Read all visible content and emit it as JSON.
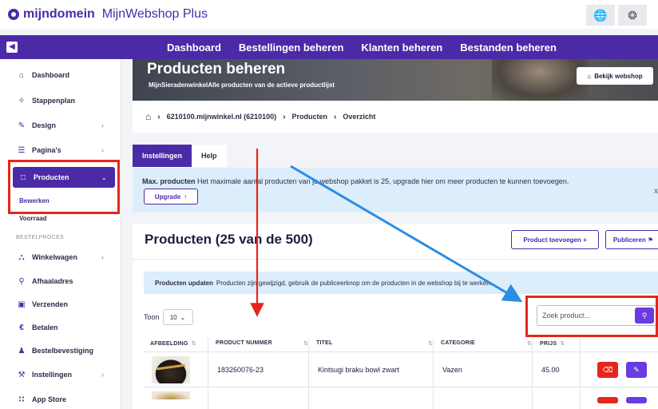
{
  "header": {
    "logo_text": "mijndomein",
    "app_name": "MijnWebshop Plus",
    "globe_icon": "globe-icon",
    "support_icon": "lifebuoy-icon"
  },
  "nav": {
    "links": [
      "Dashboard",
      "Bestellingen beheren",
      "Klanten beheren",
      "Bestanden beheren"
    ]
  },
  "sidebar": {
    "items": [
      {
        "label": "Dashboard",
        "icon": "home-icon"
      },
      {
        "label": "Stappenplan",
        "icon": "wand-icon"
      },
      {
        "label": "Design",
        "icon": "design-icon"
      },
      {
        "label": "Pagina's",
        "icon": "layers-icon"
      },
      {
        "label": "Producten",
        "icon": "box-icon"
      }
    ],
    "sub_items": [
      "Bewerken",
      "Voorraad"
    ],
    "section_label": "BESTELPROCES",
    "section_items": [
      {
        "label": "Winkelwagen",
        "icon": "cart-icon"
      },
      {
        "label": "Afhaaladres",
        "icon": "pin-icon"
      },
      {
        "label": "Verzenden",
        "icon": "truck-icon"
      },
      {
        "label": "Betalen",
        "icon": "euro-icon"
      },
      {
        "label": "Bestelbevestiging",
        "icon": "user-check-icon"
      },
      {
        "label": "Instellingen",
        "icon": "wrench-icon"
      },
      {
        "label": "App Store",
        "icon": "grid-icon"
      }
    ]
  },
  "banner": {
    "title": "Producten beheren",
    "subtitle": "MijnSieradenwinkelAlle producten van de actieve productlijst",
    "webshop_button": "Bekijk webshop"
  },
  "breadcrumb": {
    "items": [
      "6210100.mijnwinkel.nl (6210100)",
      "Producten",
      "Overzicht"
    ]
  },
  "tabs": [
    "Instellingen",
    "Help"
  ],
  "alert_max": {
    "title": "Max. producten",
    "text": "Het maximale aantal producten van je webshop pakket is 25, upgrade hier om meer producten te kunnen toevoegen.",
    "button": "Upgrade",
    "close": "x"
  },
  "products": {
    "title": "Producten (25 van de 500)",
    "add_button": "Product toevoegen",
    "publish_button": "Publiceren",
    "update_title": "Producten updaten",
    "update_text": "Producten zijn gewijzigd, gebruik de publiceerknop om de producten in de webshop bij te werken.",
    "show_label": "Toon",
    "show_value": "10",
    "search_placeholder": "Zoek product...",
    "columns": [
      "AFBEELDING",
      "PRODUCT NUMMER",
      "TITEL",
      "CATEGORIE",
      "PRIJS"
    ],
    "rows": [
      {
        "number": "183260076-23",
        "title": "Kintsugi braku bowl zwart",
        "category": "Vazen",
        "price": "45.00"
      }
    ]
  },
  "colors": {
    "brand": "#4b2aa8",
    "highlight_red": "#e5261c",
    "arrow_blue": "#2b8de3",
    "info_bg": "#dceefc"
  }
}
